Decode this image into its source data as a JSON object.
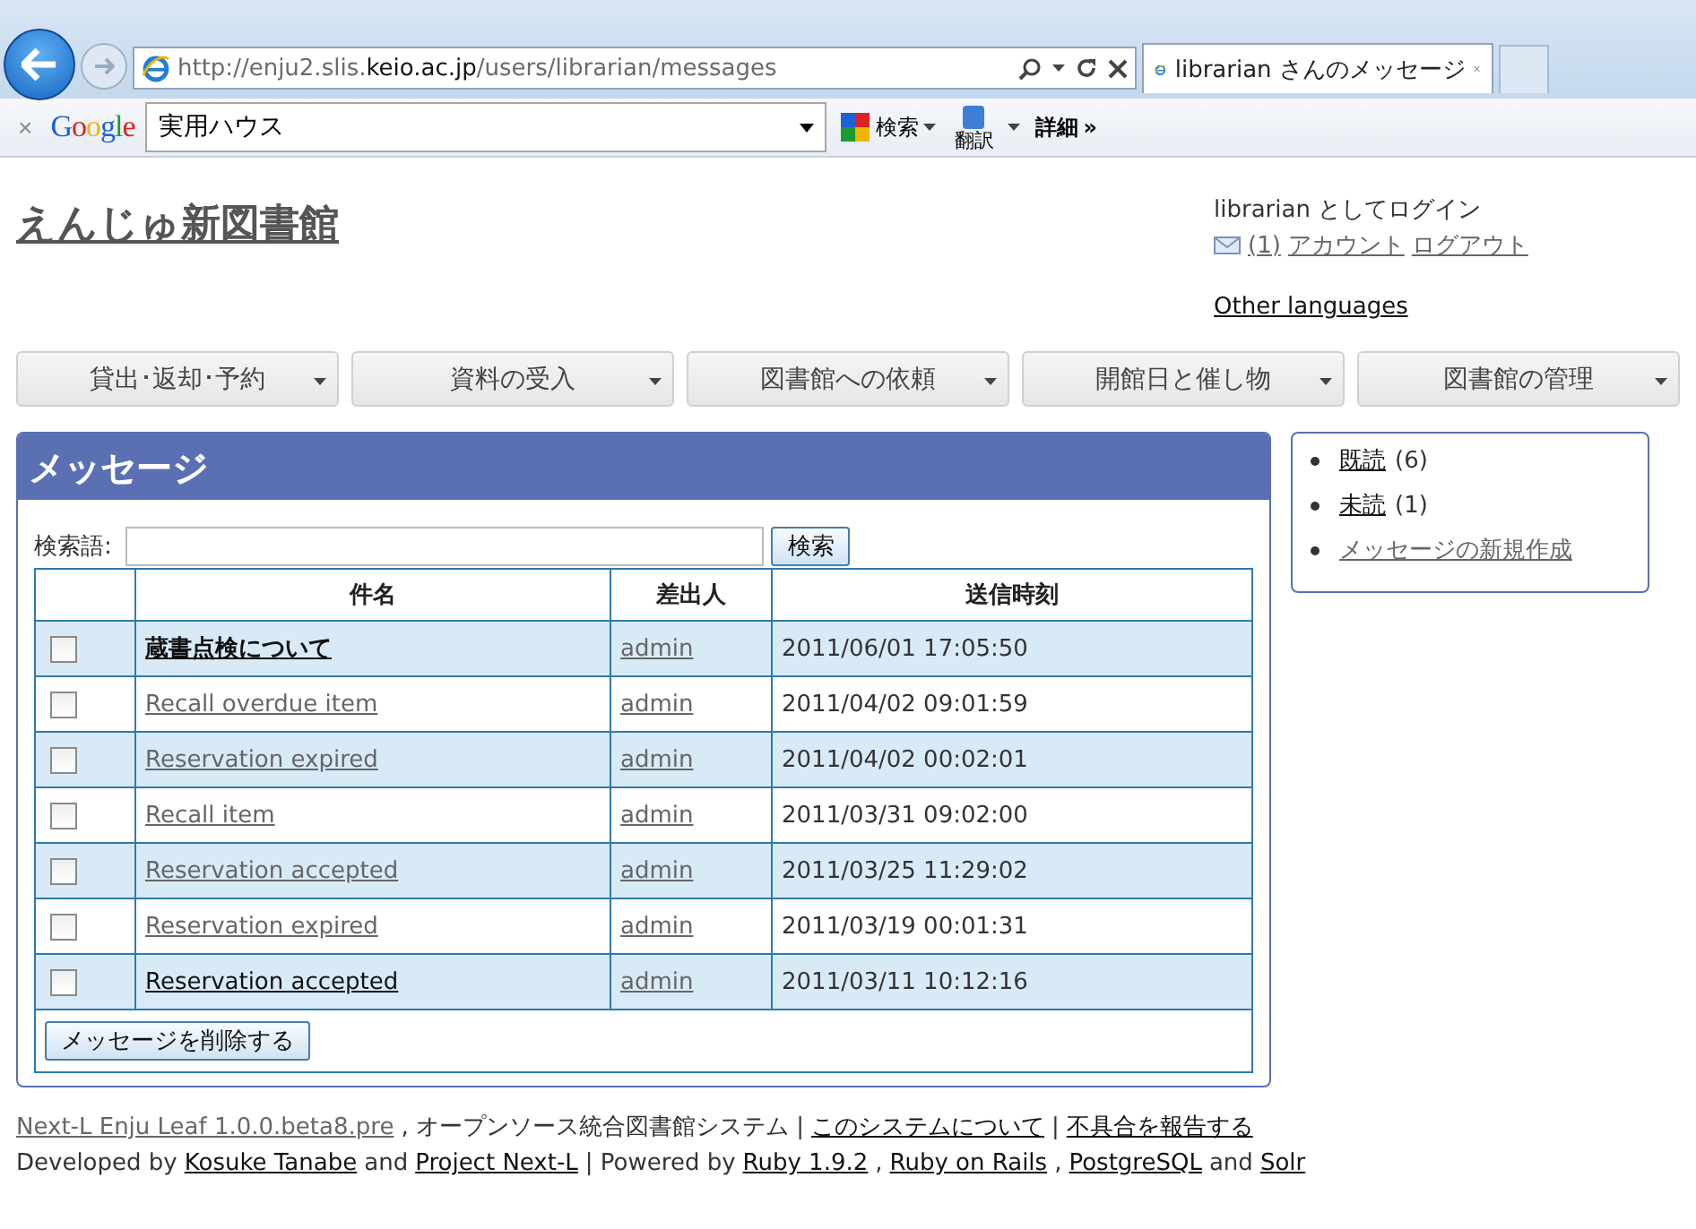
{
  "browser": {
    "url": {
      "prefix": "http://enju2.slis.",
      "host": "keio.ac.jp",
      "path": "/users/librarian/messages"
    },
    "tab": {
      "title": "librarian さんのメッセージ",
      "selected": true
    }
  },
  "toolbar": {
    "close": "×",
    "logo": "Google",
    "search_value": "実用ハウス",
    "search_button": "検索",
    "translate_button": "翻訳",
    "more_button": "詳細",
    "more_glyph": "»"
  },
  "header": {
    "site_title": "えんじゅ新図書館",
    "login_text": "librarian としてログイン",
    "links": [
      {
        "label": "(1)",
        "visited": true
      },
      {
        "label": "アカウント",
        "visited": true
      },
      {
        "label": "ログアウト",
        "visited": true
      }
    ],
    "other_languages": {
      "label": "Other languages",
      "visited": false
    }
  },
  "menu": [
    "貸出･返却･予約",
    "資料の受入",
    "図書館への依頼",
    "開館日と催し物",
    "図書館の管理"
  ],
  "messages": {
    "title": "メッセージ",
    "search_label": "検索語:",
    "search_button": "検索",
    "columns": [
      "件名",
      "差出人",
      "送信時刻"
    ],
    "rows": [
      {
        "checked": false,
        "subject": "蔵書点検について",
        "unread": true,
        "visited": false,
        "sender": "admin",
        "sent_at": "2011/06/01 17:05:50"
      },
      {
        "checked": false,
        "subject": "Recall overdue item",
        "unread": false,
        "visited": true,
        "sender": "admin",
        "sent_at": "2011/04/02 09:01:59"
      },
      {
        "checked": false,
        "subject": "Reservation expired",
        "unread": false,
        "visited": true,
        "sender": "admin",
        "sent_at": "2011/04/02 00:02:01"
      },
      {
        "checked": false,
        "subject": "Recall item",
        "unread": false,
        "visited": true,
        "sender": "admin",
        "sent_at": "2011/03/31 09:02:00"
      },
      {
        "checked": false,
        "subject": "Reservation accepted",
        "unread": false,
        "visited": true,
        "sender": "admin",
        "sent_at": "2011/03/25 11:29:02"
      },
      {
        "checked": false,
        "subject": "Reservation expired",
        "unread": false,
        "visited": true,
        "sender": "admin",
        "sent_at": "2011/03/19 00:01:31"
      },
      {
        "checked": false,
        "subject": "Reservation accepted",
        "unread": false,
        "visited": false,
        "sender": "admin",
        "sent_at": "2011/03/11 10:12:16"
      }
    ],
    "delete_button": "メッセージを削除する"
  },
  "sidebar": [
    {
      "label": "既読",
      "count": "(6)",
      "visited": false
    },
    {
      "label": "未読",
      "count": "(1)",
      "visited": false
    },
    {
      "label": "メッセージの新規作成",
      "visited": true
    }
  ],
  "footer": [
    [
      {
        "kind": "link",
        "text": "Next-L Enju Leaf 1.0.0.beta8.pre",
        "visited": true
      },
      {
        "kind": "text",
        "text": ", オープンソース統合図書館システム |"
      },
      {
        "kind": "link",
        "text": "このシステムについて",
        "visited": false
      },
      {
        "kind": "text",
        "text": "|"
      },
      {
        "kind": "link",
        "text": "不具合を報告する",
        "visited": false
      }
    ],
    [
      {
        "kind": "text",
        "text": "Developed by"
      },
      {
        "kind": "link",
        "text": "Kosuke Tanabe",
        "visited": false
      },
      {
        "kind": "text",
        "text": "and"
      },
      {
        "kind": "link",
        "text": "Project Next-L",
        "visited": false
      },
      {
        "kind": "text",
        "text": "| Powered by"
      },
      {
        "kind": "link",
        "text": "Ruby 1.9.2",
        "visited": false
      },
      {
        "kind": "text",
        "text": ","
      },
      {
        "kind": "link",
        "text": "Ruby on Rails",
        "visited": false
      },
      {
        "kind": "text",
        "text": ","
      },
      {
        "kind": "link",
        "text": "PostgreSQL",
        "visited": false
      },
      {
        "kind": "text",
        "text": "and"
      },
      {
        "kind": "link",
        "text": "Solr",
        "visited": false
      }
    ]
  ]
}
